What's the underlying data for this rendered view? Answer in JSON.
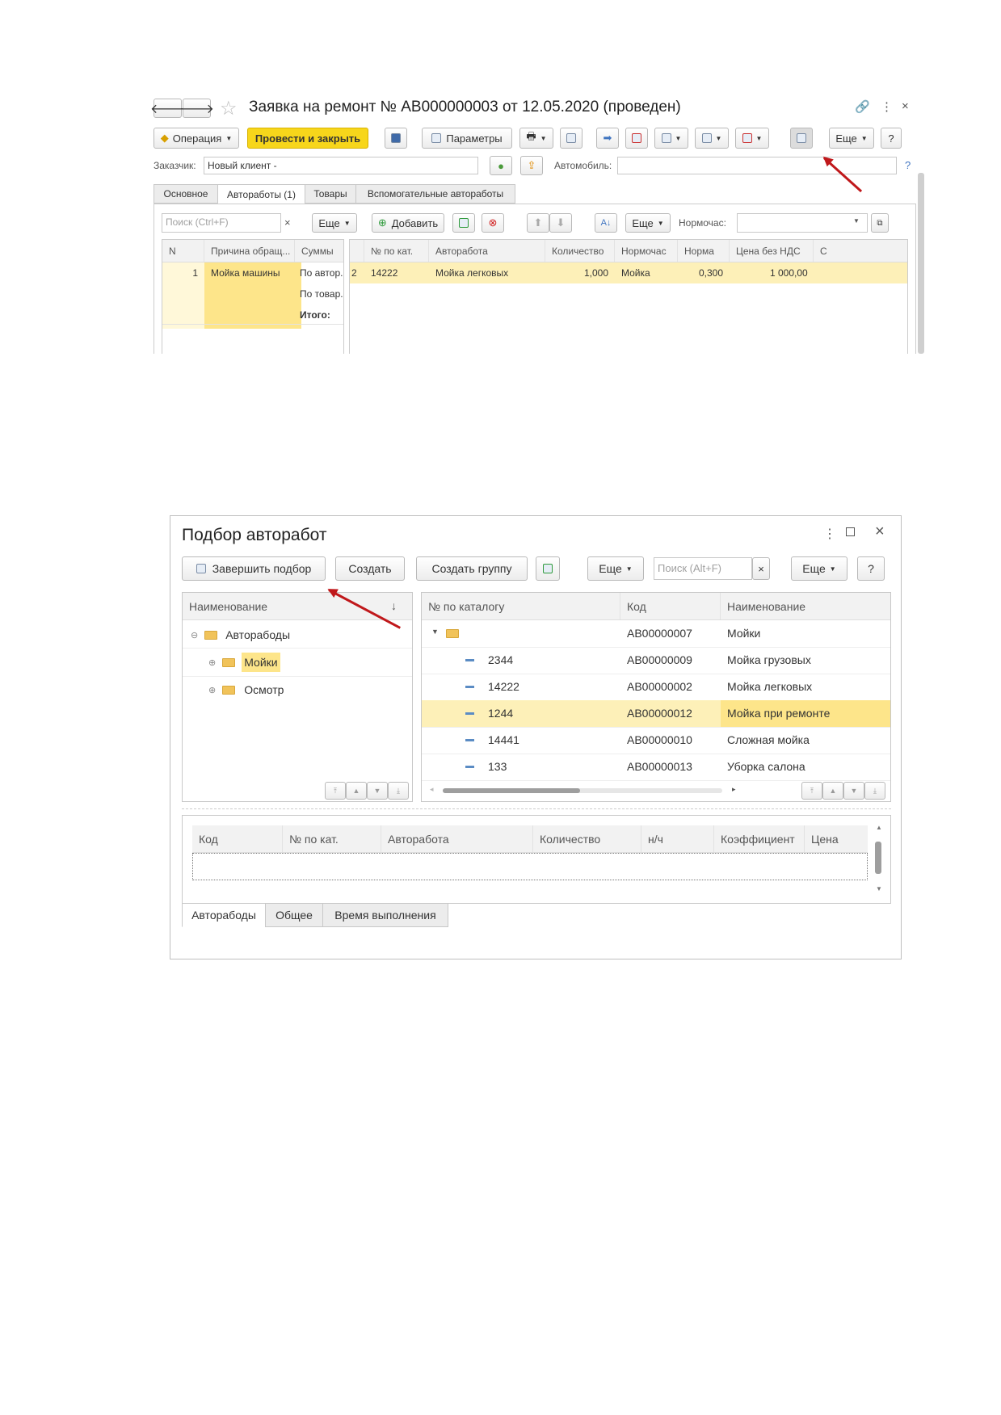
{
  "top": {
    "title": "Заявка на ремонт № АВ000000003 от 12.05.2020 (проведен)",
    "toolbar": {
      "operation": "Операция",
      "post_close": "Провести и закрыть",
      "params": "Параметры",
      "more": "Еще",
      "help": "?"
    },
    "customer_label": "Заказчик:",
    "customer_value": "Новый клиент -",
    "car_label": "Автомобиль:",
    "help_q": "?",
    "tabs": [
      "Основное",
      "Автоработы (1)",
      "Товары",
      "Вспомогательные автоработы"
    ],
    "search_placeholder": "Поиск (Ctrl+F)",
    "more": "Еще",
    "add": "Добавить",
    "norm_hour_label": "Нормочас:",
    "left_cols": [
      "N",
      "Причина обращ...",
      "Суммы"
    ],
    "left_row": {
      "n": "1",
      "reason": "Мойка машины",
      "sums": [
        "По автор.",
        "По товар.",
        "Итого:"
      ]
    },
    "right_cols": [
      "№ по кат.",
      "Авторабота",
      "Количество",
      "Нормочас",
      "Норма",
      "Цена без НДС",
      "С"
    ],
    "right_row": {
      "prefix": "2",
      "cat": "14222",
      "work": "Мойка легковых",
      "qty": "1,000",
      "nh": "Мойка",
      "norm": "0,300",
      "price": "1 000,00"
    }
  },
  "bottom": {
    "title": "Подбор авторабот",
    "toolbar": {
      "finish": "Завершить подбор",
      "create": "Создать",
      "create_group": "Создать группу",
      "more": "Еще",
      "search_placeholder": "Поиск (Alt+F)",
      "more2": "Еще",
      "help": "?"
    },
    "tree": {
      "header": "Наименование",
      "sort_icon": "↓",
      "root": "Авторабоды",
      "children": [
        "Мойки",
        "Осмотр"
      ]
    },
    "list": {
      "cols": [
        "№ по каталогу",
        "Код",
        "Наименование"
      ],
      "rows": [
        {
          "cat": "",
          "code": "АВ00000007",
          "name": "Мойки"
        },
        {
          "cat": "2344",
          "code": "АВ00000009",
          "name": "Мойка грузовых"
        },
        {
          "cat": "14222",
          "code": "АВ00000002",
          "name": "Мойка легковых"
        },
        {
          "cat": "1244",
          "code": "АВ00000012",
          "name": "Мойка при ремонте"
        },
        {
          "cat": "14441",
          "code": "АВ00000010",
          "name": "Сложная мойка"
        },
        {
          "cat": "133",
          "code": "АВ00000013",
          "name": "Уборка салона"
        }
      ]
    },
    "selected_cols": [
      "Код",
      "№ по кат.",
      "Авторабота",
      "Количество",
      "н/ч",
      "Коэффициент",
      "Цена"
    ],
    "tabs": [
      "Авторабоды",
      "Общее",
      "Время выполнения"
    ]
  }
}
